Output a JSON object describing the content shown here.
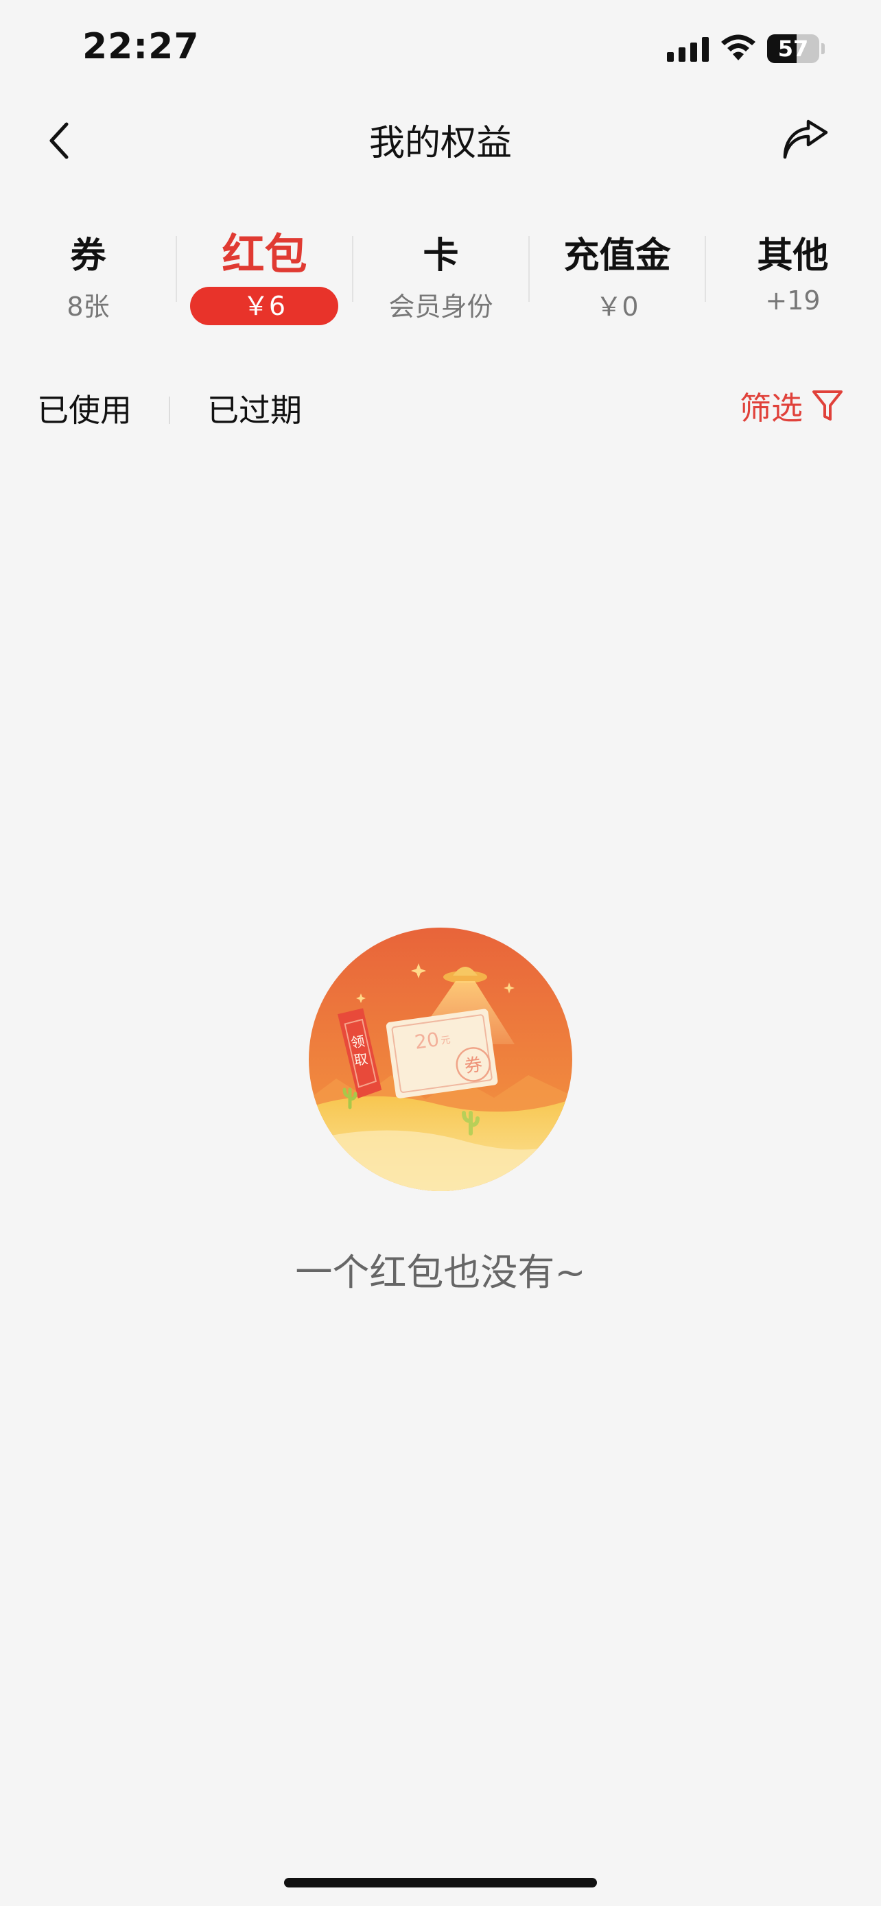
{
  "status_bar": {
    "time": "22:27",
    "battery": "57",
    "battery_level": 0.57
  },
  "header": {
    "title": "我的权益"
  },
  "tabs": [
    {
      "label": "券",
      "sub": "8张",
      "active": false
    },
    {
      "label": "红包",
      "sub": "￥6",
      "active": true
    },
    {
      "label": "卡",
      "sub": "会员身份",
      "active": false
    },
    {
      "label": "充值金",
      "sub": "￥0",
      "active": false
    },
    {
      "label": "其他",
      "sub": "+19",
      "active": false
    }
  ],
  "filters": {
    "used": "已使用",
    "expired": "已过期",
    "filter_label": "筛选"
  },
  "empty_state": {
    "message": "一个红包也没有~",
    "illustration": {
      "banner_text": "领取",
      "ticket_text": "20",
      "ticket_unit": "元",
      "stamp_text": "券"
    }
  },
  "colors": {
    "accent": "#e8332a",
    "background": "#f5f5f5"
  }
}
